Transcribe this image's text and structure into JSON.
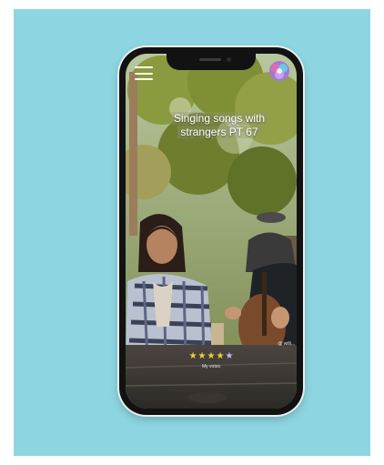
{
  "video": {
    "caption": "Singing songs with strangers PT 67",
    "user_tag": "@ willi..."
  },
  "rating": {
    "stars": 5,
    "filled": 4,
    "label": "My votes",
    "filled_color": "#f0d23a",
    "empty_color": "#c3b6f0"
  },
  "icons": {
    "menu": "hamburger-menu-icon",
    "logo": "app-logo-icon",
    "star": "star-icon"
  },
  "colors": {
    "background": "#8dd6e1",
    "phone_frame": "#121212"
  }
}
